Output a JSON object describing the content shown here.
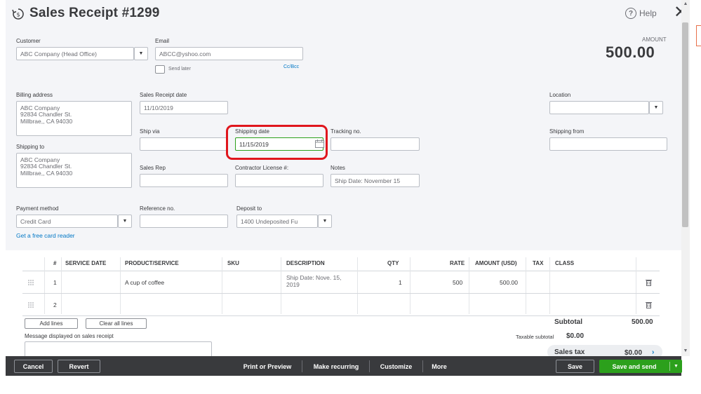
{
  "header": {
    "title": "Sales Receipt #1299",
    "help_label": "Help",
    "close_symbol": "✕"
  },
  "amount": {
    "label": "AMOUNT",
    "value": "500.00"
  },
  "customer": {
    "label": "Customer",
    "value": "ABC Company (Head Office)"
  },
  "email": {
    "label": "Email",
    "value": "ABCC@yshoo.com",
    "send_later_label": "Send later",
    "cc_bcc_label": "Cc/Bcc"
  },
  "billing_address": {
    "label": "Billing address",
    "value": "ABC Company\n92834 Chandler St.\nMillbrae,, CA  94030"
  },
  "sales_receipt_date": {
    "label": "Sales Receipt date",
    "value": "11/10/2019"
  },
  "location": {
    "label": "Location",
    "value": ""
  },
  "ship_via": {
    "label": "Ship via",
    "value": ""
  },
  "shipping_date": {
    "label": "Shipping date",
    "value": "11/15/2019"
  },
  "tracking_no": {
    "label": "Tracking no.",
    "value": ""
  },
  "shipping_from": {
    "label": "Shipping from",
    "value": ""
  },
  "shipping_to": {
    "label": "Shipping to",
    "value": "ABC Company\n92834 Chandler St.\nMillbrae,, CA  94030"
  },
  "sales_rep": {
    "label": "Sales Rep",
    "value": ""
  },
  "contractor_license": {
    "label": "Contractor License #:",
    "value": ""
  },
  "notes": {
    "label": "Notes",
    "value": "Ship Date: November 15"
  },
  "payment_method": {
    "label": "Payment method",
    "value": "Credit Card"
  },
  "reference_no": {
    "label": "Reference no.",
    "value": ""
  },
  "deposit_to": {
    "label": "Deposit to",
    "value": "1400 Undeposited Fu"
  },
  "card_reader_link": "Get a free card reader",
  "table": {
    "headers": [
      "#",
      "SERVICE DATE",
      "PRODUCT/SERVICE",
      "SKU",
      "DESCRIPTION",
      "QTY",
      "RATE",
      "AMOUNT (USD)",
      "TAX",
      "CLASS"
    ],
    "rows": [
      {
        "num": "1",
        "service_date": "",
        "product": "A cup of coffee",
        "sku": "",
        "description": "Ship Date: Nove. 15,\n2019",
        "qty": "1",
        "rate": "500",
        "amount": "500.00",
        "tax": "",
        "class": ""
      },
      {
        "num": "2",
        "service_date": "",
        "product": "",
        "sku": "",
        "description": "",
        "qty": "",
        "rate": "",
        "amount": "",
        "tax": "",
        "class": ""
      }
    ]
  },
  "add_lines_label": "Add lines",
  "clear_lines_label": "Clear all lines",
  "message_label": "Message displayed on sales receipt",
  "totals": {
    "subtotal_label": "Subtotal",
    "subtotal_value": "500.00",
    "taxable_label": "Taxable subtotal",
    "taxable_value": "$0.00",
    "sales_tax_label": "Sales tax",
    "sales_tax_value": "$0.00"
  },
  "footer": {
    "cancel": "Cancel",
    "revert": "Revert",
    "print_preview": "Print or Preview",
    "make_recurring": "Make recurring",
    "customize": "Customize",
    "more": "More",
    "save": "Save",
    "save_and_send": "Save and send"
  },
  "colors": {
    "accent_green": "#2ca01c",
    "highlight_red": "#e0161d",
    "link_blue": "#0077c5",
    "footer_bg": "#393a3d"
  }
}
